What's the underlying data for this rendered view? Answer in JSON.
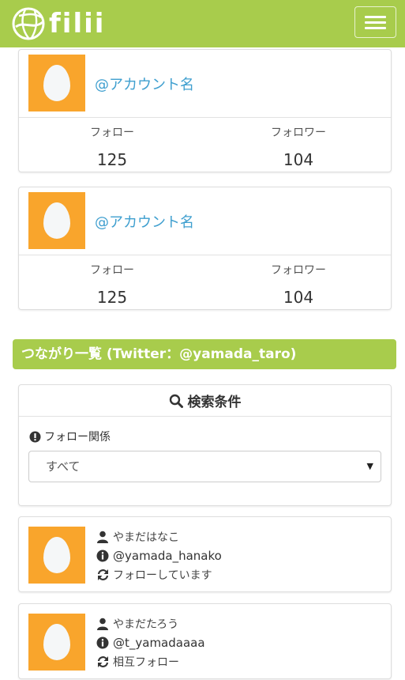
{
  "header": {
    "logo_text": "filii",
    "menu_icon": "hamburger-icon",
    "brand_color": "#a8cc4c"
  },
  "accounts": [
    {
      "name": "@アカウント名",
      "follow_label": "フォロー",
      "follow_count": "125",
      "follower_label": "フォロワー",
      "follower_count": "104"
    },
    {
      "name": "@アカウント名",
      "follow_label": "フォロー",
      "follow_count": "125",
      "follower_label": "フォロワー",
      "follower_count": "104"
    }
  ],
  "section": {
    "title": "つながり一覧 (Twitter：@yamada_taro)"
  },
  "search": {
    "title": "検索条件",
    "filter_label": "フォロー関係",
    "selected": "すべて"
  },
  "users": [
    {
      "display_name": "やまだはなこ",
      "handle": "@yamada_hanako",
      "relation": "フォローしています"
    },
    {
      "display_name": "やまだたろう",
      "handle": "@t_yamadaaaa",
      "relation": "相互フォロー"
    }
  ],
  "colors": {
    "avatar_bg": "#f9a52c",
    "link": "#3f9fcf"
  }
}
